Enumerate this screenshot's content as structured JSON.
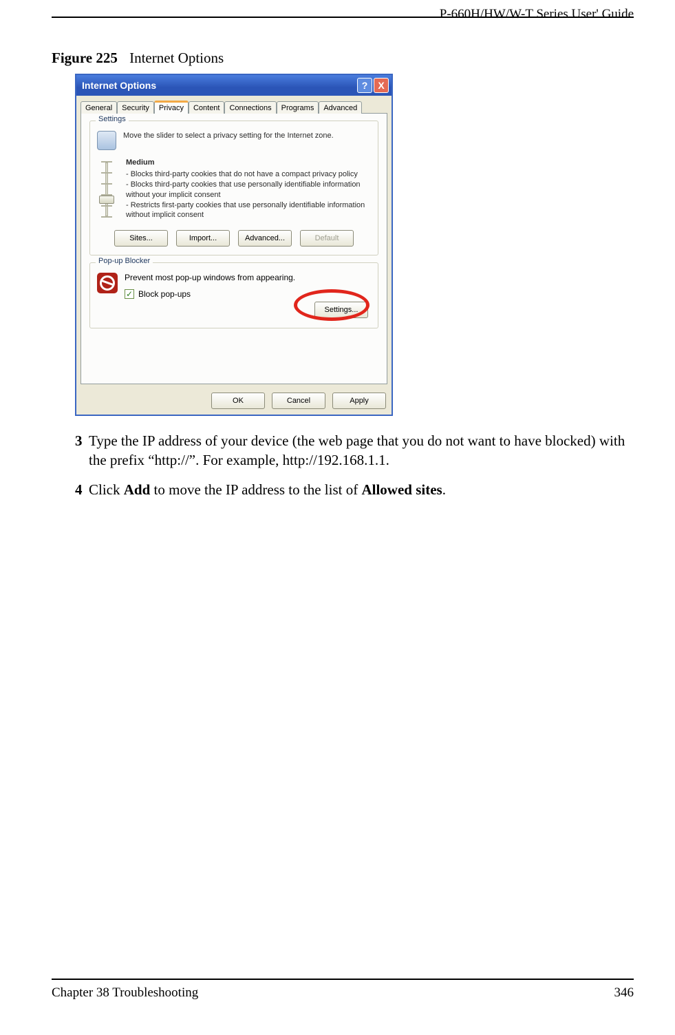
{
  "doc": {
    "header_right": "P-660H/HW/W-T Series User' Guide",
    "figure_label": "Figure 225",
    "figure_title": "Internet Options",
    "footer_left": "Chapter 38 Troubleshooting",
    "footer_right": "346"
  },
  "dialog": {
    "title": "Internet Options",
    "tabs": [
      "General",
      "Security",
      "Privacy",
      "Content",
      "Connections",
      "Programs",
      "Advanced"
    ],
    "active_tab_index": 2,
    "settings_group": {
      "legend": "Settings",
      "desc": "Move the slider to select a privacy setting for the Internet zone.",
      "level_name": "Medium",
      "level_desc": "- Blocks third-party cookies that do not have a compact privacy policy\n- Blocks third-party cookies that use personally identifiable information without your implicit consent\n- Restricts first-party cookies that use personally identifiable information without implicit consent",
      "buttons": {
        "sites": "Sites...",
        "import": "Import...",
        "advanced": "Advanced...",
        "default": "Default"
      }
    },
    "popup_group": {
      "legend": "Pop-up Blocker",
      "desc": "Prevent most pop-up windows from appearing.",
      "checkbox_label": "Block pop-ups",
      "checkbox_checked": true,
      "settings_btn": "Settings..."
    },
    "footer_buttons": {
      "ok": "OK",
      "cancel": "Cancel",
      "apply": "Apply"
    }
  },
  "steps": {
    "s3_num": "3",
    "s3_text": "Type the IP address of your device (the web page that you do not want to have blocked) with the prefix “http://”. For example, http://192.168.1.1.",
    "s4_num": "4",
    "s4_pre": "Click ",
    "s4_b1": "Add",
    "s4_mid": " to move the IP address to the list of ",
    "s4_b2": "Allowed sites",
    "s4_post": "."
  }
}
